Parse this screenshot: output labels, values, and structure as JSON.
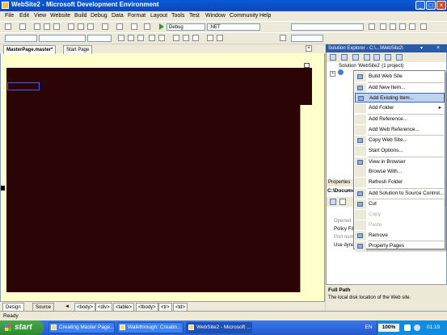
{
  "window": {
    "title": "WebSite2 - Microsoft Development Environment",
    "minimize": "_",
    "maximize": "□",
    "close": "×"
  },
  "menu": [
    "File",
    "Edit",
    "View",
    "Website",
    "Build",
    "Debug",
    "Data",
    "Format",
    "Layout",
    "Tools",
    "Test",
    "Window",
    "Community",
    "Help"
  ],
  "toolbar": {
    "config_combo": "Debug",
    "platform_combo": ".NET"
  },
  "document_tabs": {
    "active": "MasterPage.master*",
    "other": "Start Page"
  },
  "editor": {
    "header_link": "",
    "footer_text": ""
  },
  "view_buttons": {
    "design": "Design",
    "source": "Source"
  },
  "tag_path": [
    "<body>",
    "<div>",
    "<table>",
    "<tbody>",
    "<tr>",
    "<td>"
  ],
  "solution_explorer": {
    "title": "Solution Explorer - C:\\...\\WebSite2\\",
    "root": "Solution 'WebSite2' (1 project)"
  },
  "context_menu": [
    {
      "label": "Build Web Site",
      "icon": "build-icon"
    },
    {
      "sep": true
    },
    {
      "label": "Add New Item...",
      "icon": "add-new-item-icon"
    },
    {
      "label": "Add Existing Item...",
      "icon": "add-existing-item-icon",
      "selected": true
    },
    {
      "label": "Add Folder",
      "submenu": true
    },
    {
      "sep": true
    },
    {
      "label": "Add Reference..."
    },
    {
      "label": "Add Web Reference..."
    },
    {
      "sep": true
    },
    {
      "label": "Copy Web Site...",
      "icon": "copy-web-icon"
    },
    {
      "label": "Start Options..."
    },
    {
      "sep": true
    },
    {
      "label": "View in Browser",
      "icon": "browser-icon"
    },
    {
      "label": "Browse With..."
    },
    {
      "label": "Refresh Folder"
    },
    {
      "sep": true
    },
    {
      "label": "Add Solution to Source Control...",
      "icon": "source-control-icon"
    },
    {
      "sep": true
    },
    {
      "label": "Cut",
      "icon": "cut-icon"
    },
    {
      "label": "Copy",
      "disabled": true
    },
    {
      "label": "Paste",
      "disabled": true
    },
    {
      "label": "Remove",
      "icon": "remove-icon"
    },
    {
      "sep": true
    },
    {
      "label": "Property Pages",
      "icon": "property-pages-icon"
    }
  ],
  "properties": {
    "title": "Properties",
    "object": "C:\\Docume",
    "rows": [
      "Opened",
      "Policy File",
      "Port num",
      "Use dyna"
    ],
    "desc_heading": "Full Path",
    "desc_text": "The local disk location of the Web site."
  },
  "status": {
    "text": "Ready"
  },
  "taskbar": {
    "start": "start",
    "tasks": [
      {
        "label": "Creating Master Page...",
        "active": false
      },
      {
        "label": "Walkthrough: Creatin...",
        "active": false
      },
      {
        "label": "WebSite2 - Microsoft ...",
        "active": true
      }
    ],
    "language": "EN",
    "battery": "100%",
    "clock": "01:19"
  },
  "colors": {
    "title_bar": "#0a5bd6",
    "editor_bg": "#ffffcc",
    "master_region": "#2b0505",
    "menu_highlight": "#c1d2ee"
  }
}
